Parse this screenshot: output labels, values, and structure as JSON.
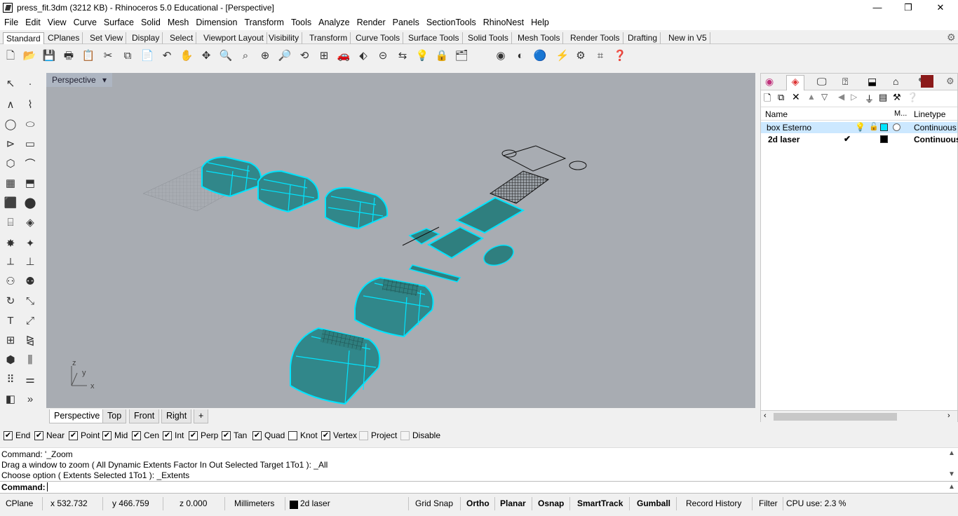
{
  "window": {
    "title": "press_fit.3dm (3212 KB) - Rhinoceros 5.0 Educational - [Perspective]",
    "minimize": "—",
    "restore": "❐",
    "close": "✕"
  },
  "menu": [
    "File",
    "Edit",
    "View",
    "Curve",
    "Surface",
    "Solid",
    "Mesh",
    "Dimension",
    "Transform",
    "Tools",
    "Analyze",
    "Render",
    "Panels",
    "SectionTools",
    "RhinoNest",
    "Help"
  ],
  "toolbar_tabs": [
    "Standard",
    "CPlanes",
    "Set View",
    "Display",
    "Select",
    "Viewport Layout",
    "Visibility",
    "Transform",
    "Curve Tools",
    "Surface Tools",
    "Solid Tools",
    "Mesh Tools",
    "Render Tools",
    "Drafting",
    "New in V5"
  ],
  "viewport": {
    "label": "Perspective",
    "menu_arrow": "▾",
    "axis_x": "x",
    "axis_y": "y",
    "axis_z": "z"
  },
  "view_tabs": [
    "Perspective",
    "Top",
    "Front",
    "Right",
    "+"
  ],
  "layers_panel": {
    "col_name": "Name",
    "col_material": "M...",
    "col_linetype": "Linetype",
    "rows": [
      {
        "name": "box Esterno",
        "linetype": "Continuous",
        "selected": true,
        "color": "#00e5ff"
      },
      {
        "name": "2d laser",
        "linetype": "Continuous",
        "current": "✔",
        "selected": false,
        "color": "#000000"
      }
    ]
  },
  "osnaps": [
    {
      "label": "End",
      "checked": true
    },
    {
      "label": "Near",
      "checked": true
    },
    {
      "label": "Point",
      "checked": true
    },
    {
      "label": "Mid",
      "checked": true
    },
    {
      "label": "Cen",
      "checked": true
    },
    {
      "label": "Int",
      "checked": true
    },
    {
      "label": "Perp",
      "checked": true
    },
    {
      "label": "Tan",
      "checked": true
    },
    {
      "label": "Quad",
      "checked": true
    },
    {
      "label": "Knot",
      "checked": false
    },
    {
      "label": "Vertex",
      "checked": true
    },
    {
      "label": "Project",
      "checked": false,
      "disabled": true
    },
    {
      "label": "Disable",
      "checked": false,
      "disabled": true
    }
  ],
  "command_history": [
    "Command: '_Zoom",
    "Drag a window to zoom ( All  Dynamic  Extents  Factor  In  Out  Selected  Target  1To1 ): _All",
    "Choose option ( Extents  Selected  1To1 ): _Extents"
  ],
  "command_prompt": "Command:",
  "status": {
    "cplane": "CPlane",
    "x": "x 532.732",
    "y": "y 466.759",
    "z": "z 0.000",
    "units": "Millimeters",
    "layer": "2d laser",
    "grid_snap": "Grid Snap",
    "ortho": "Ortho",
    "planar": "Planar",
    "osnap": "Osnap",
    "smarttrack": "SmartTrack",
    "gumball": "Gumball",
    "record_history": "Record History",
    "filter": "Filter",
    "cpu": "CPU use: 2.3 %"
  },
  "colors": {
    "accent_cyan": "#00e5ff",
    "viewport_bg": "#a8acb2",
    "selection_blue": "#cce8ff"
  }
}
